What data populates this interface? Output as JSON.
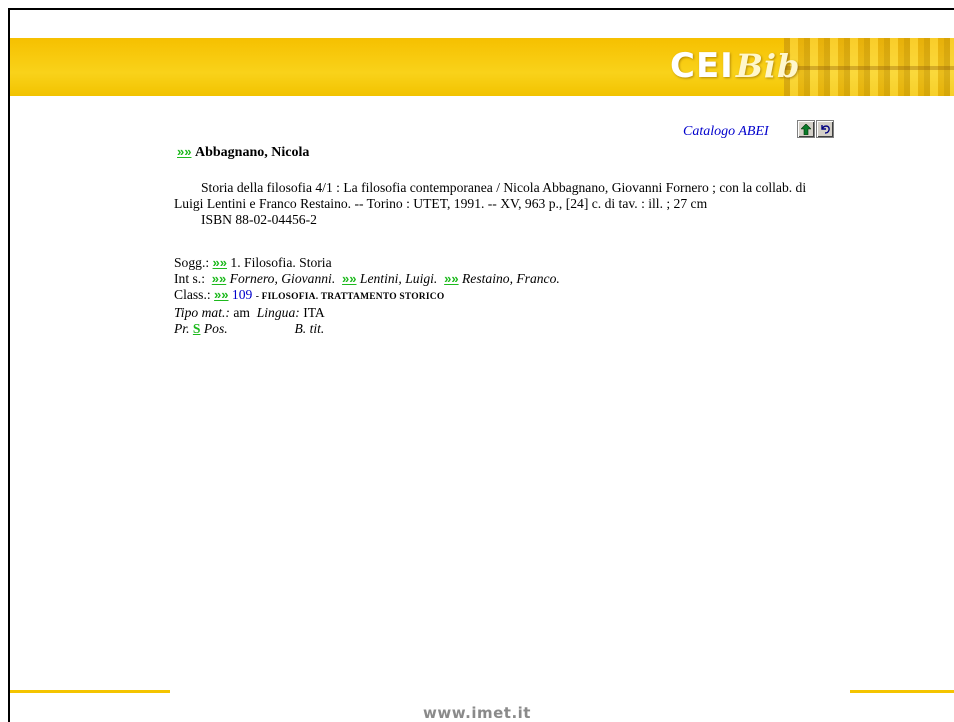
{
  "banner": {
    "logo_main": "CEI",
    "logo_sub": "Bib"
  },
  "header": {
    "catalog_label": "Catalogo ABEI"
  },
  "record": {
    "author_prefix": "»»",
    "author": "Abbagnano, Nicola",
    "description_line1": "Storia della filosofia 4/1 : La filosofia contemporanea / Nicola Abbagnano, Giovanni Fornero ; con la collab. di",
    "description_line2": "Luigi Lentini e Franco Restaino. -- Torino : UTET, 1991. -- XV, 963 p., [24] c. di tav. : ill. ; 27 cm",
    "isbn": "ISBN 88-02-04456-2"
  },
  "meta": {
    "link_glyph": "»»",
    "sogg_label": "Sogg.:",
    "sogg_value": "1. Filosofia. Storia",
    "ints_label": "Int s.:",
    "ints_names": [
      "Fornero, Giovanni.",
      "Lentini, Luigi.",
      "Restaino, Franco."
    ],
    "class_label": "Class.:",
    "class_number": "109",
    "class_desc": "- FILOSOFIA. TRATTAMENTO STORICO",
    "tipo_label": "Tipo mat.:",
    "tipo_value": "am",
    "lingua_label": "Lingua:",
    "lingua_value": "ITA",
    "pr_label": "Pr.",
    "pr_value": "S",
    "pos_label": "Pos.",
    "btit_label": "B. tit."
  },
  "footer": {
    "url": "www.imet.it"
  },
  "colors": {
    "banner_yellow": "#f6c000",
    "link_green": "#1db91d",
    "link_blue": "#0000cc"
  }
}
